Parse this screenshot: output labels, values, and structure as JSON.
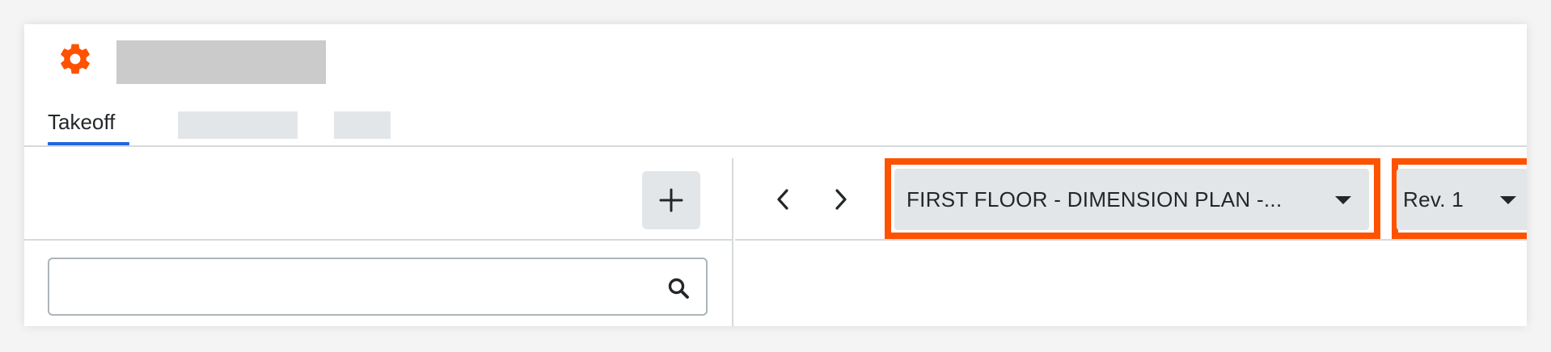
{
  "header": {
    "gear_icon": "gear-icon",
    "accent_color": "#ff5200"
  },
  "tabs": [
    {
      "label": "Takeoff",
      "active": true
    }
  ],
  "left_panel": {
    "add_icon": "plus-icon",
    "search": {
      "value": "",
      "placeholder": "",
      "icon": "search-icon"
    }
  },
  "drawing_toolbar": {
    "prev_icon": "chevron-left-icon",
    "next_icon": "chevron-right-icon",
    "drawing_select": {
      "value": "FIRST FLOOR - DIMENSION PLAN -..."
    },
    "revision_select": {
      "value": "Rev. 1"
    },
    "highlight_color": "#ff5200"
  }
}
